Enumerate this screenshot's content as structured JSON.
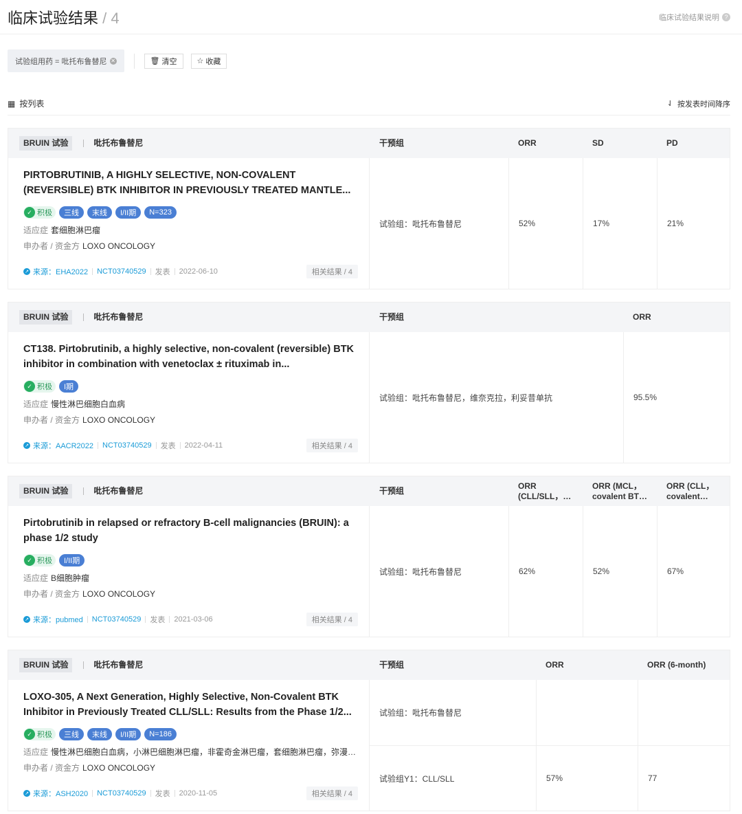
{
  "header": {
    "title": "临床试验结果",
    "count": "/ 4",
    "help_label": "临床试验结果说明",
    "help_icon": "?"
  },
  "filters": {
    "chip_label": "试验组用药 = 吡托布鲁替尼",
    "clear_label": "清空",
    "favorite_label": "收藏"
  },
  "view": {
    "mode_label": "按列表",
    "sort_label": "按发表时间降序"
  },
  "cards": [
    {
      "trial": "BRUIN 试验",
      "drug": "吡托布鲁替尼",
      "intervention_header": "干预组",
      "metric_headers": [
        "ORR",
        "SD",
        "PD"
      ],
      "title": "PIRTOBRUTINIB, A HIGHLY SELECTIVE, NON-COVALENT (REVERSIBLE) BTK INHIBITOR IN PREVIOUSLY TREATED MANTLE...",
      "positive_label": "积极",
      "badges": [
        "三线",
        "末线",
        "I/II期",
        "N=323"
      ],
      "indication_label": "适应症",
      "indication": "套细胞淋巴瘤",
      "sponsor_label": "申办者 / 资金方",
      "sponsor": "LOXO ONCOLOGY",
      "source": "来源：EHA2022",
      "nct": "NCT03740529",
      "published_label": "发表",
      "date": "2022-06-10",
      "related": "相关结果 / 4",
      "rows": [
        {
          "group": "试验组：吡托布鲁替尼",
          "values": [
            "52%",
            "17%",
            "21%"
          ]
        }
      ]
    },
    {
      "trial": "BRUIN 试验",
      "drug": "吡托布鲁替尼",
      "intervention_header": "干预组",
      "metric_headers": [
        "ORR"
      ],
      "title": "CT138. Pirtobrutinib, a highly selective, non-covalent (reversible) BTK inhibitor in combination with venetoclax ± rituximab in...",
      "positive_label": "积极",
      "badges": [
        "I期"
      ],
      "indication_label": "适应症",
      "indication": "慢性淋巴细胞白血病",
      "sponsor_label": "申办者 / 资金方",
      "sponsor": "LOXO ONCOLOGY",
      "source": "来源：AACR2022",
      "nct": "NCT03740529",
      "published_label": "发表",
      "date": "2022-04-11",
      "related": "相关结果 / 4",
      "rows": [
        {
          "group": "试验组：吡托布鲁替尼，维奈克拉，利妥昔单抗",
          "values": [
            "95.5%"
          ]
        }
      ]
    },
    {
      "trial": "BRUIN 试验",
      "drug": "吡托布鲁替尼",
      "intervention_header": "干预组",
      "metric_headers": [
        "ORR (CLL/SLL，covalent…",
        "ORR (MCL，covalent BT…",
        "ORR (CLL，covalent BT…"
      ],
      "title": "Pirtobrutinib in relapsed or refractory B-cell malignancies (BRUIN): a phase 1/2 study",
      "positive_label": "积极",
      "badges": [
        "I/II期"
      ],
      "indication_label": "适应症",
      "indication": "B细胞肿瘤",
      "sponsor_label": "申办者 / 资金方",
      "sponsor": "LOXO ONCOLOGY",
      "source": "来源：pubmed",
      "nct": "NCT03740529",
      "published_label": "发表",
      "date": "2021-03-06",
      "related": "相关结果 / 4",
      "rows": [
        {
          "group": "试验组：吡托布鲁替尼",
          "values": [
            "62%",
            "52%",
            "67%"
          ]
        }
      ]
    },
    {
      "trial": "BRUIN 试验",
      "drug": "吡托布鲁替尼",
      "intervention_header": "干预组",
      "metric_headers": [
        "ORR",
        "ORR (6-month)"
      ],
      "title": "LOXO-305, A Next Generation, Highly Selective, Non-Covalent BTK Inhibitor in Previously Treated CLL/SLL: Results from the Phase 1/2...",
      "positive_label": "积极",
      "badges": [
        "三线",
        "末线",
        "I/II期",
        "N=186"
      ],
      "indication_label": "适应症",
      "indication": "慢性淋巴细胞白血病，小淋巴细胞淋巴瘤，非霍奇金淋巴瘤，套细胞淋巴瘤，弥漫性...",
      "sponsor_label": "申办者 / 资金方",
      "sponsor": "LOXO ONCOLOGY",
      "source": "来源：ASH2020",
      "nct": "NCT03740529",
      "published_label": "发表",
      "date": "2020-11-05",
      "related": "相关结果 / 4",
      "rows": [
        {
          "group": "试验组：吡托布鲁替尼",
          "values": [
            "",
            ""
          ]
        },
        {
          "group": "试验组Y1：CLL/SLL",
          "values": [
            "57%",
            "77"
          ]
        }
      ]
    }
  ]
}
